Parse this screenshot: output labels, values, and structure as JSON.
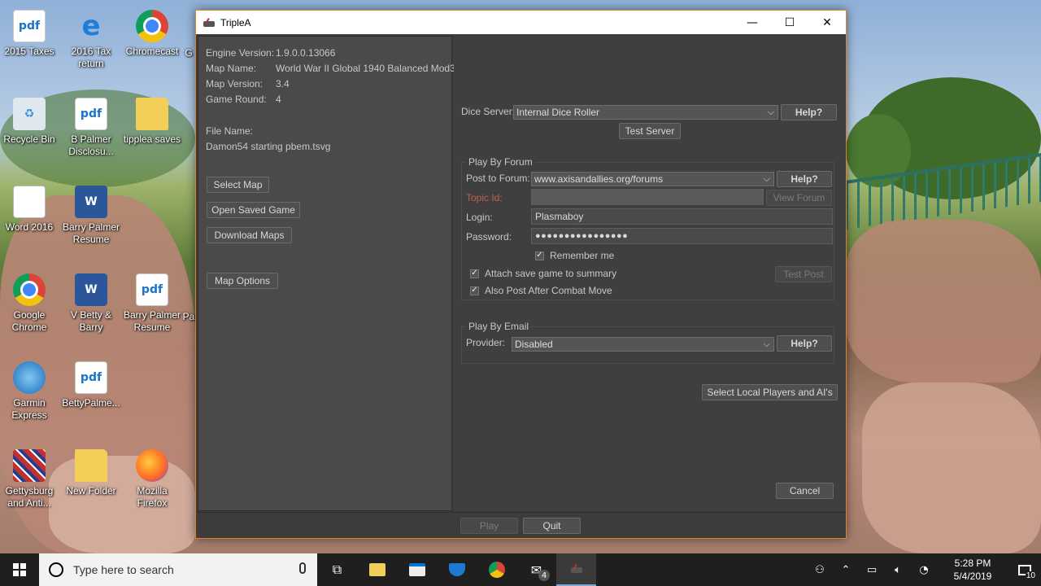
{
  "desktop": {
    "icons": [
      {
        "label": "2015 Taxes",
        "icon": "pdf-icon"
      },
      {
        "label": "2016 Tax return",
        "icon": "edge-icon"
      },
      {
        "label": "Chromecast",
        "icon": "chrome-icon"
      },
      {
        "label": "Recycle Bin",
        "icon": "recycle-bin-icon"
      },
      {
        "label": "B Palmer Disclosu...",
        "icon": "pdf-icon"
      },
      {
        "label": "tipplea saves",
        "icon": "folder-icon"
      },
      {
        "label": "Word 2016",
        "icon": "document-icon"
      },
      {
        "label": "Barry Palmer Resume",
        "icon": "word-icon"
      },
      {
        "label": "Google Chrome",
        "icon": "chrome-icon"
      },
      {
        "label": "V Betty & Barry",
        "icon": "word-icon"
      },
      {
        "label": "Barry Palmer Resume",
        "icon": "pdf-icon"
      },
      {
        "label": "Garmin Express",
        "icon": "garmin-icon"
      },
      {
        "label": "BettyPalme...",
        "icon": "pdf-icon"
      },
      {
        "label": "Gettysburg and Anti...",
        "icon": "flag-icon"
      },
      {
        "label": "New Folder",
        "icon": "folder-icon"
      },
      {
        "label": "Mozilla Firefox",
        "icon": "firefox-icon"
      }
    ],
    "partial_labels": [
      "G",
      "Pa"
    ]
  },
  "window": {
    "title": "TripleA",
    "controls": {
      "minimize": "—",
      "maximize": "☐",
      "close": "✕"
    }
  },
  "game_info": {
    "engine_version_label": "Engine Version:",
    "engine_version": "1.9.0.0.13066",
    "map_name_label": "Map Name:",
    "map_name": "World War II Global 1940 Balanced Mod3",
    "map_version_label": "Map Version:",
    "map_version": "3.4",
    "game_round_label": "Game Round:",
    "game_round": "4",
    "file_name_label": "File Name:",
    "file_name": "Damon54 starting pbem.tsvg"
  },
  "left_buttons": {
    "select_map": "Select Map",
    "open_saved_game": "Open Saved Game",
    "download_maps": "Download Maps",
    "map_options": "Map Options"
  },
  "dice": {
    "label": "Dice Server:",
    "selected": "Internal Dice Roller",
    "help": "Help?",
    "test_server": "Test Server"
  },
  "forum": {
    "legend": "Play By Forum",
    "post_label": "Post to Forum:",
    "post_selected": "www.axisandallies.org/forums",
    "help": "Help?",
    "topic_label": "Topic Id:",
    "topic_value": "",
    "view_forum": "View Forum",
    "login_label": "Login:",
    "login_value": "Plasmaboy",
    "password_label": "Password:",
    "password_value": "●●●●●●●●●●●●●●●●",
    "remember_me": "Remember me",
    "attach_save": "Attach save game to summary",
    "also_post": "Also Post After Combat Move",
    "test_post": "Test Post"
  },
  "email": {
    "legend": "Play By Email",
    "provider_label": "Provider:",
    "provider_selected": "Disabled",
    "help": "Help?"
  },
  "actions": {
    "select_players": "Select Local Players and AI's",
    "cancel": "Cancel",
    "play": "Play",
    "quit": "Quit"
  },
  "taskbar": {
    "search_placeholder": "Type here to search",
    "mail_badge": "4",
    "time": "5:28 PM",
    "date": "5/4/2019",
    "notification_count": "10"
  }
}
